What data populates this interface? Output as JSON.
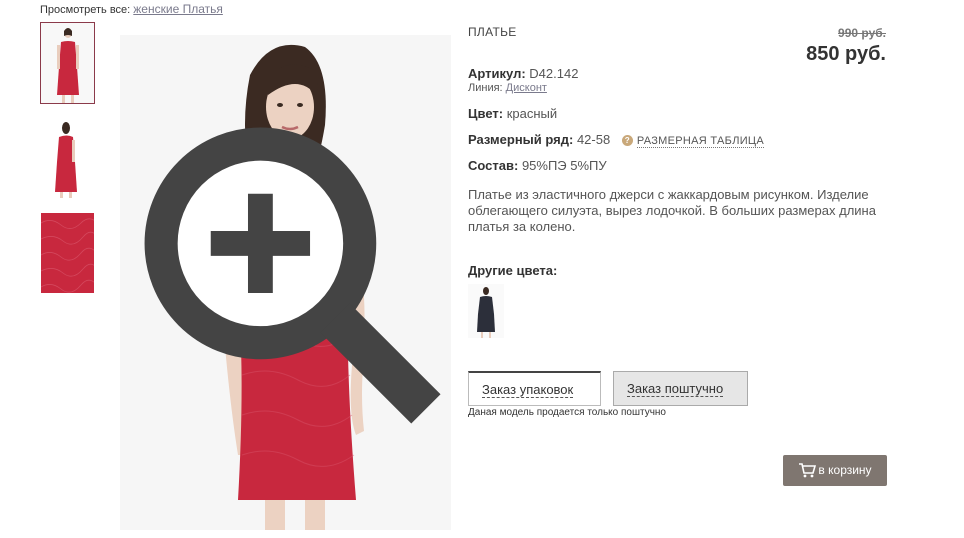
{
  "breadcrumb": {
    "prefix": "Просмотреть все:",
    "link": "женские Платья"
  },
  "product": {
    "title": "ПЛАТЬЕ",
    "price_old": "990 руб.",
    "price_new": "850 руб.",
    "article_label": "Артикул:",
    "article_value": "D42.142",
    "line_label": "Линия:",
    "line_value": "Дисконт",
    "color_label": "Цвет:",
    "color_value": "красный",
    "size_label": "Размерный ряд:",
    "size_value": "42-58",
    "size_table": "РАЗМЕРНАЯ ТАБЛИЦА",
    "composition_label": "Состав:",
    "composition_value": "95%ПЭ 5%ПУ",
    "description": "Платье из эластичного джерси с жаккардовым рисунком. Изделие облегающего силуэта, вырез лодочкой. В больших размерах длина платья за колено.",
    "other_colors_label": "Другие цвета:"
  },
  "order": {
    "tab_pack": "Заказ упаковок",
    "tab_piece": "Заказ поштучно",
    "note": "Даная модель продается только поштучно",
    "cart_button": "в корзину"
  },
  "colors": {
    "dress_red": "#c8283e",
    "other_dress": "#2c2f3a",
    "cart_bg": "#7f7670",
    "link": "#7a7a8c"
  },
  "icons": [
    "zoom-in-icon",
    "question-icon",
    "cart-icon"
  ]
}
